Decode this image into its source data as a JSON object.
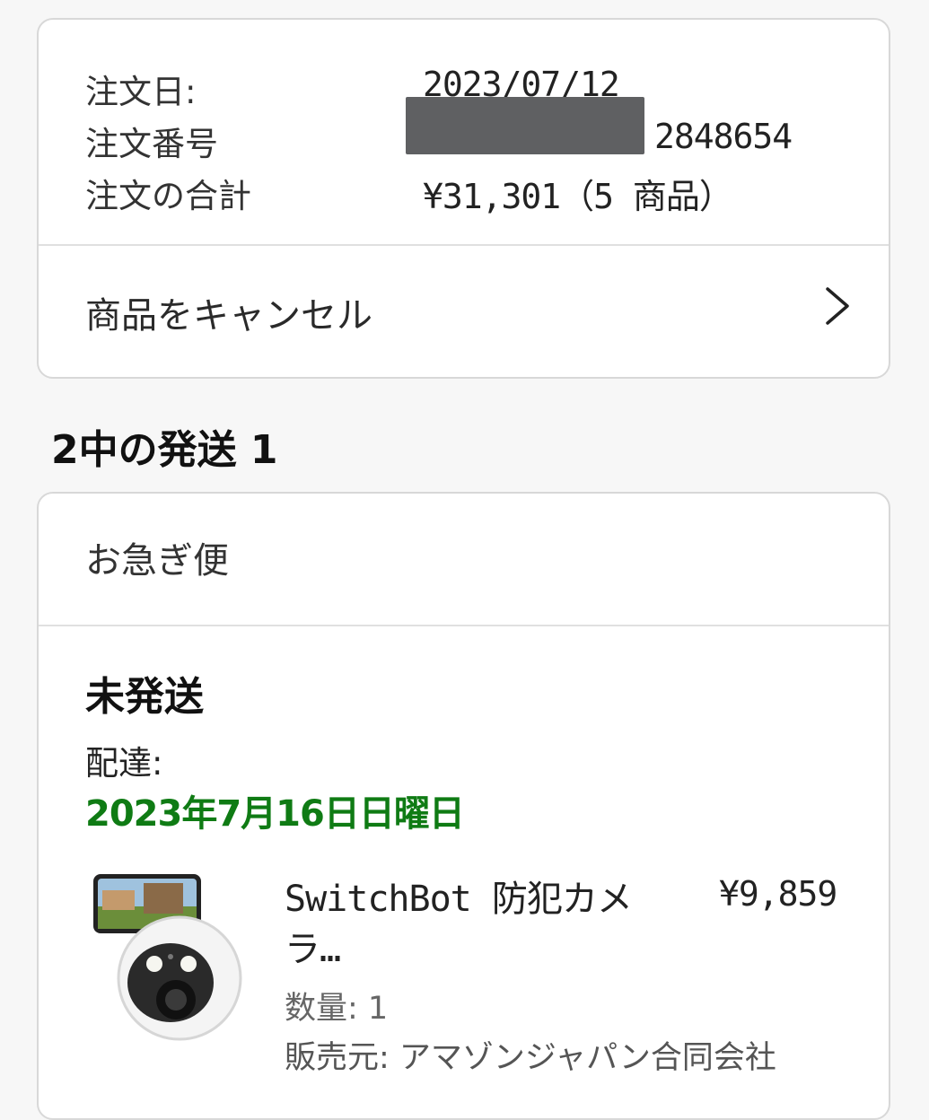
{
  "order": {
    "date_label": "注文日:",
    "date_value": "2023/07/12",
    "number_label": "注文番号",
    "number_value_visible": "2848654",
    "total_label": "注文の合計",
    "total_value": "¥31,301（5 商品）"
  },
  "cancel": {
    "label": "商品をキャンセル"
  },
  "shipment_heading": "2中の発送 1",
  "shipment": {
    "speed": "お急ぎ便",
    "status": "未発送",
    "delivery_label": "配達:",
    "delivery_date": "2023年7月16日日曜日",
    "delivery_date_color": "#0f7b14"
  },
  "item": {
    "title": "SwitchBot 防犯カメラ…",
    "price": "¥9,859",
    "quantity": "数量: 1",
    "seller": "販売元: アマゾンジャパン合同会社",
    "image": "security-camera-product-image"
  }
}
